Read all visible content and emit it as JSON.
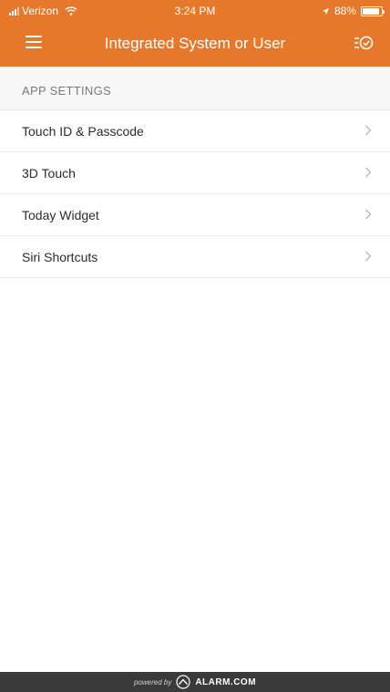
{
  "status_bar": {
    "carrier": "Verizon",
    "time": "3:24 PM",
    "battery": "88%",
    "battery_level": 0.88
  },
  "nav": {
    "title": "Integrated System or User",
    "menu_icon": "hamburger-menu-icon",
    "action_icon": "checklist-icon"
  },
  "section": {
    "title": "APP SETTINGS"
  },
  "settings_items": [
    {
      "label": "Touch ID & Passcode"
    },
    {
      "label": "3D Touch"
    },
    {
      "label": "Today Widget"
    },
    {
      "label": "Siri Shortcuts"
    }
  ],
  "footer": {
    "powered_by": "powered by",
    "brand": "ALARM.COM"
  },
  "colors": {
    "accent": "#E5782A",
    "footer": "#3A3A3A"
  }
}
